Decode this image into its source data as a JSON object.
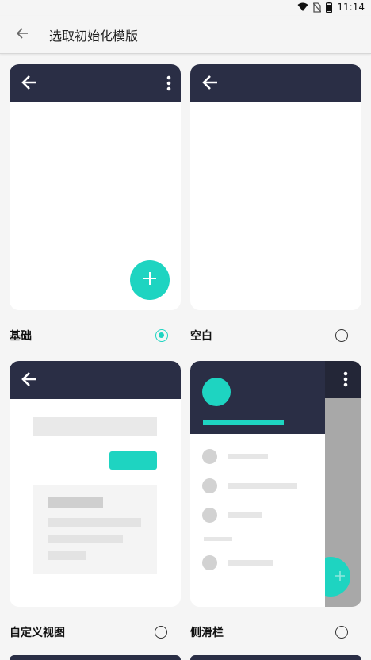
{
  "status": {
    "time": "11:14"
  },
  "app_bar": {
    "title": "选取初始化模版"
  },
  "templates": [
    {
      "name": "基础",
      "selected": true
    },
    {
      "name": "空白",
      "selected": false
    },
    {
      "name": "自定义视图",
      "selected": false
    },
    {
      "name": "侧滑栏",
      "selected": false
    }
  ],
  "colors": {
    "header": "#2a2e45",
    "accent": "#1ed4c1",
    "background": "#f5f5f5",
    "card": "#ffffff"
  }
}
